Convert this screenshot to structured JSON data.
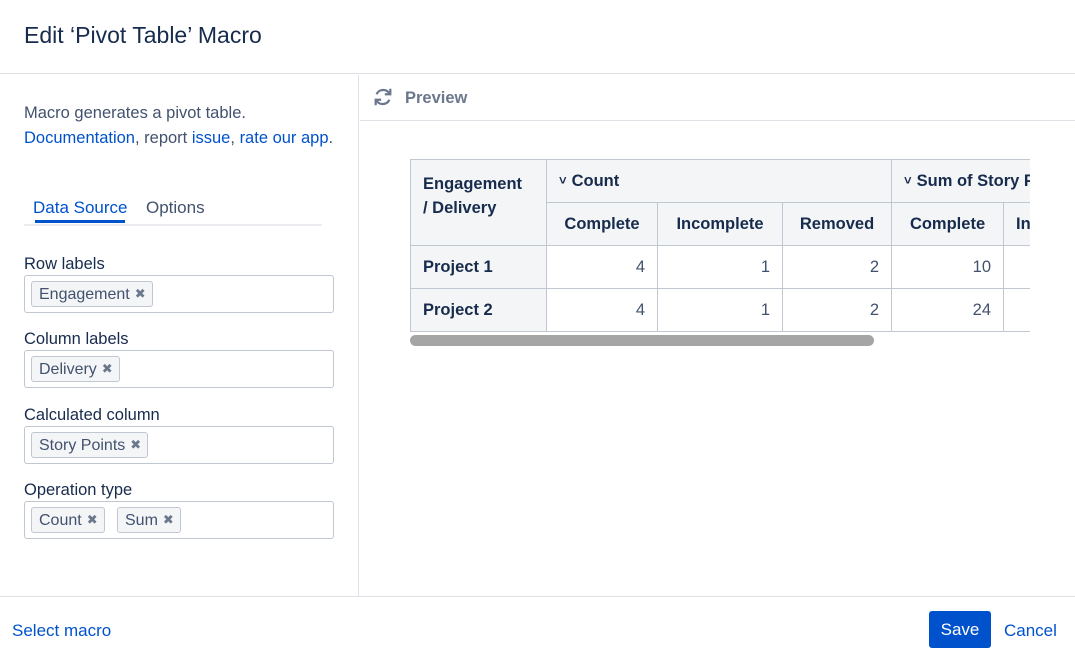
{
  "dialog": {
    "title": "Edit ‘Pivot Table’ Macro"
  },
  "left_panel": {
    "description_text": "Macro generates a pivot table.",
    "documentation_link": "Documentation",
    "report_text": ", report ",
    "issue_link": "issue",
    "comma": ",",
    "rate_link": "rate our app",
    "period": ".",
    "tabs": [
      {
        "label": "Data Source",
        "active": true
      },
      {
        "label": "Options",
        "active": false
      }
    ],
    "fields": [
      {
        "label": "Row labels",
        "chips": [
          "Engagement"
        ]
      },
      {
        "label": "Column labels",
        "chips": [
          "Delivery"
        ]
      },
      {
        "label": "Calculated column",
        "chips": [
          "Story Points"
        ]
      },
      {
        "label": "Operation type",
        "chips": [
          "Count",
          "Sum"
        ]
      }
    ],
    "chip_remove_glyph": "✖"
  },
  "preview": {
    "title": "Preview",
    "icon": "refresh-icon",
    "table": {
      "corner_line1": "Engagement",
      "corner_line2": "/ Delivery",
      "groups": [
        "Count",
        "Sum of Story Points"
      ],
      "group_chevron": "˅",
      "sub_headers": [
        "Complete",
        "Incomplete",
        "Removed",
        "Complete",
        "Incomplete"
      ],
      "rows": [
        {
          "label": "Project 1",
          "values": [
            "4",
            "1",
            "2",
            "10",
            ""
          ]
        },
        {
          "label": "Project 2",
          "values": [
            "4",
            "1",
            "2",
            "24",
            ""
          ]
        }
      ]
    }
  },
  "footer": {
    "select_macro": "Select macro",
    "save": "Save",
    "cancel": "Cancel"
  },
  "colors": {
    "accent": "#0052cc",
    "border": "#dfe1e6",
    "header_bg": "#f4f5f7"
  }
}
